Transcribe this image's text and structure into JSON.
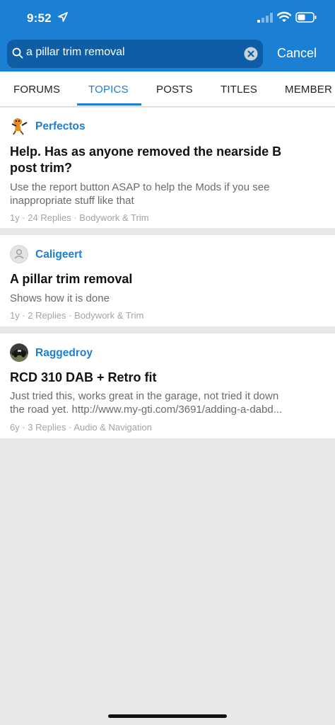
{
  "status_bar": {
    "time": "9:52"
  },
  "search": {
    "query": "a pillar trim removal",
    "cancel_label": "Cancel"
  },
  "tabs": [
    {
      "label": "FORUMS"
    },
    {
      "label": "TOPICS",
      "active": true
    },
    {
      "label": "POSTS"
    },
    {
      "label": "TITLES"
    },
    {
      "label": "MEMBER"
    }
  ],
  "results": [
    {
      "author": "Perfectos",
      "title_line1": "Help. Has as anyone removed the nearside B",
      "title_line2": "post trim?",
      "snippet_line1": "Use the report button ASAP to help the Mods if you see",
      "snippet_line2": "inappropriate stuff like that",
      "age": "1y",
      "replies": "24 Replies",
      "forum": "Bodywork & Trim"
    },
    {
      "author": "Caligeert",
      "title": "A pillar trim removal",
      "snippet": "Shows how it is done",
      "age": "1y",
      "replies": "2 Replies",
      "forum": "Bodywork & Trim"
    },
    {
      "author": "Raggedroy",
      "title": "RCD 310 DAB + Retro fit",
      "snippet_line1": "Just tried this, works great in the garage, not tried it down",
      "snippet_line2": "the road yet.  http://www.my-gti.com/3691/adding-a-dabd...",
      "age": "6y",
      "replies": "3 Replies",
      "forum": "Audio & Navigation"
    }
  ],
  "colors": {
    "accent": "#1b7fd3",
    "search_field": "#0f5ea5",
    "background": "#e8e8e8"
  }
}
